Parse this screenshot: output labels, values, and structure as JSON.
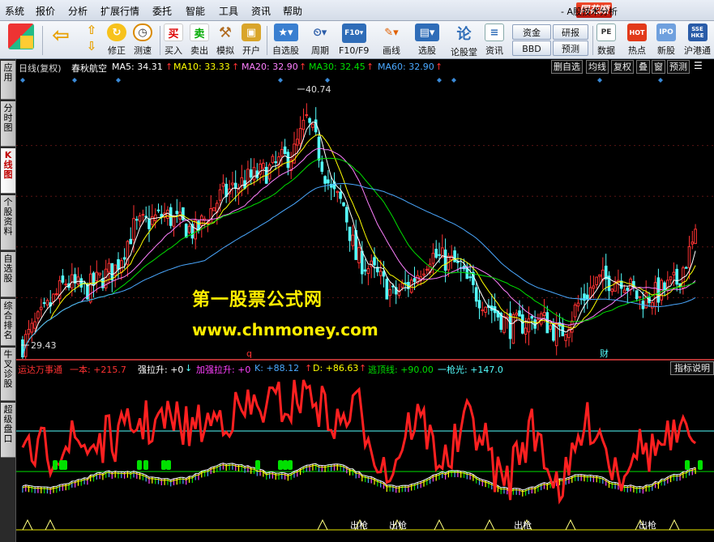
{
  "menu": [
    "系统",
    "报价",
    "分析",
    "扩展行情",
    "委托",
    "智能",
    "工具",
    "资讯",
    "帮助"
  ],
  "brand": "同花顺",
  "app_title": "- A股技术分析",
  "toolbar": {
    "buttons": [
      "修正",
      "测速",
      "买入",
      "卖出",
      "模拟",
      "开户",
      "自选股",
      "周期",
      "F10/F9",
      "画线",
      "选股",
      "论股堂",
      "资讯",
      "数据",
      "热点",
      "新股",
      "沪港通"
    ],
    "small": [
      "资金",
      "BBD",
      "研报",
      "预测"
    ]
  },
  "sidebar": [
    "应用",
    "分时图",
    "K线图",
    "个股资料",
    "自选股",
    "综合排名",
    "牛叉诊股",
    "超级盘口"
  ],
  "chart_header": {
    "period": "日线(复权)",
    "name": "春秋航空",
    "ma5": "MA5: 34.31",
    "ma10": "MA10: 33.33",
    "ma20": "MA20: 32.90",
    "ma30": "MA30: 32.45",
    "ma60": "MA60: 32.90",
    "buttons": [
      "删自选",
      "均线",
      "复权",
      "叠",
      "窗",
      "预测"
    ]
  },
  "price_high": "40.74",
  "price_low": "29.43",
  "marker_q": "q",
  "marker_cai": "财",
  "watermark": {
    "line1": "第一股票公式网",
    "line2": "www.chnmoney.com"
  },
  "indicator_header": {
    "name": "运达万事通",
    "yiben": "一本: +215.7",
    "qianglasheng": "强拉升: +0",
    "jiaqiang": "加强拉升: +0",
    "k": "K: +88.12",
    "d": "D: +86.63",
    "taoding": "逃顶线: +90.00",
    "yiqiangguang": "一枪光: +147.0",
    "button": "指标说明"
  },
  "indicator_labels": [
    "出枪",
    "出枪",
    "出枪",
    "出枪"
  ],
  "colors": {
    "up": "#ff3232",
    "down": "#54ffff",
    "ma5": "#ffffff",
    "ma10": "#ffff00",
    "ma20": "#ff80ff",
    "ma30": "#00e000",
    "ma60": "#4aa8ff"
  }
}
